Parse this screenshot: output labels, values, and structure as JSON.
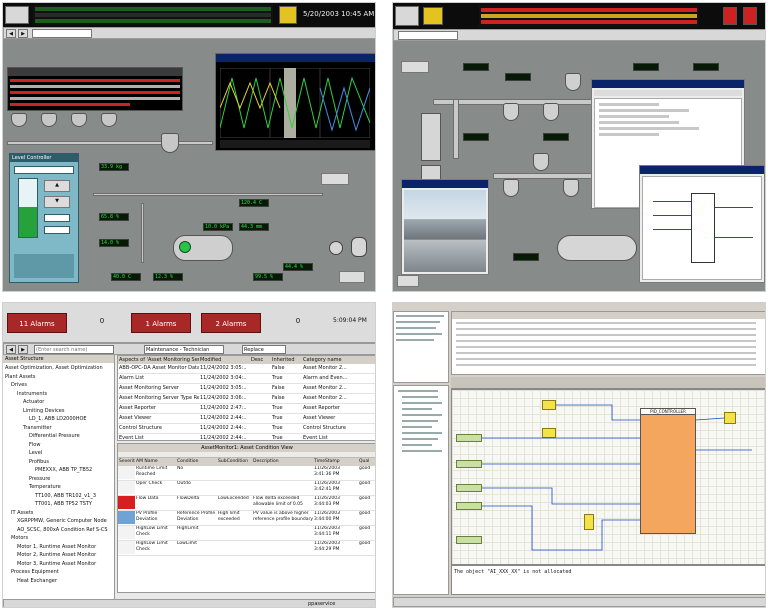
{
  "top_left": {
    "clock": "5/20/2003 10:45 AM",
    "readouts": [
      "10.0 kPa",
      "44.3 mm",
      "120.4 C",
      "44.4 %",
      "40.0 C",
      "12.3 %",
      "99.5 %",
      "33.9 kg",
      "65.8 %",
      "14.0 %"
    ],
    "faceplate_title": "Level Controller"
  },
  "bottom_left": {
    "alarms": [
      {
        "label": "11 Alarms",
        "count": "0"
      },
      {
        "label": "1 Alarms",
        "count": ""
      },
      {
        "label": "2 Alarms",
        "count": "0"
      }
    ],
    "clock": "5:09:04 PM",
    "search_placeholder": "(Enter search name)",
    "structure_combo": "Maintenance - Technician",
    "replace_label": "Replace",
    "tree_header": "Asset Structure",
    "tree": [
      "Asset Optimization, Asset Optimization",
      "Plant Assets",
      "Drives",
      "Instruments",
      "Actuator",
      "Limiting Devices",
      "LD_1, ABB LD2000HOE",
      "Transmitter",
      "Differential Pressure",
      "Flow",
      "Level",
      "Profibus",
      "PMEXXX, ABB TP_TB52",
      "Pressure",
      "Temperature",
      "TT100, ABB TR102_v1_3",
      "TT001, ABB TP52 TSTY",
      "IT Assets",
      "XGRPPMW, Generic Computer Node",
      "AO_SCSC, 800xA Condition Ref S-CS",
      "Motors",
      "Motor 1, Runtime Asset Monitor",
      "Motor 2, Runtime Asset Monitor",
      "Motor 3, Runtime Asset Monitor",
      "Process Equipment",
      "Heat Exchanger"
    ],
    "aspects_columns": [
      "Aspects of 'Asset Monitoring Server'",
      "Modified",
      "Desc",
      "Inherited",
      "Category name"
    ],
    "aspects_rows": [
      [
        "ABB-OPC-DA Asset Monitor Data",
        "11/24/2002 3:05:..",
        "",
        "False",
        "Asset Monitor 2..."
      ],
      [
        "Alarm List",
        "11/24/2002 3:04:..",
        "",
        "True",
        "Alarm and Even..."
      ],
      [
        "Asset Monitoring Server",
        "11/24/2002 3:05:..",
        "",
        "False",
        "Asset Monitor 2..."
      ],
      [
        "Asset Monitoring Server Type Ref...",
        "11/24/2002 3:06:..",
        "",
        "False",
        "Asset Monitor 2..."
      ],
      [
        "Asset Reporter",
        "11/24/2002 2:47:..",
        "",
        "True",
        "Asset Reporter"
      ],
      [
        "Asset Viewer",
        "11/24/2002 2:44:..",
        "",
        "True",
        "Asset Viewer"
      ],
      [
        "Control Structure",
        "11/24/2002 2:44:..",
        "",
        "True",
        "Control Structure"
      ],
      [
        "Event List",
        "11/24/2002 2:44:..",
        "",
        "True",
        "Event List"
      ]
    ],
    "condition_title": "AssetMonitor1: Asset Condition View",
    "condition_columns": [
      "Severity",
      "AM Name",
      "Condition",
      "SubCondition",
      "Description",
      "TimeStamp",
      "Qual"
    ],
    "condition_rows": [
      [
        "",
        "Runtime Limit Reached",
        "No",
        "",
        "",
        "11/26/2003 3:41:36 PM",
        "good"
      ],
      [
        "",
        "Oper Check",
        "Outdo",
        "",
        "",
        "11/26/2003 3:42:41 PM",
        "good"
      ],
      [
        "",
        "Flow Data",
        "FlowDelta",
        "LowExceeded",
        "Flow delta exceeded allowable limit of 0.05",
        "11/26/2003 3:44:03 PM",
        "good"
      ],
      [
        "",
        "PV Profile Deviation",
        "Reference Profile Deviation",
        "High limit exceeded",
        "PV value is above higher reference profile boundary",
        "11/26/2003 3:44:00 PM",
        "good"
      ],
      [
        "",
        "HighLow Limit Check",
        "HighLimit",
        "",
        "",
        "11/26/2003 3:44:11 PM",
        "good"
      ],
      [
        "",
        "HighLow Limit Check",
        "LowLimit",
        "",
        "",
        "11/26/2003 3:44:29 PM",
        "good"
      ]
    ],
    "user": "ppaservice"
  },
  "bottom_right": {
    "diagram_block_title": "PID_CONTROLLER",
    "status_message": "The object \"AI_XXX_XX\" is not allocated"
  },
  "colors": {
    "alarm_red": "#a82828",
    "process_gray": "#878c8a",
    "faceplate_teal": "#7fb9c7",
    "function_block_orange": "#f4a65f",
    "diagram_yellow": "#f2e34a"
  }
}
